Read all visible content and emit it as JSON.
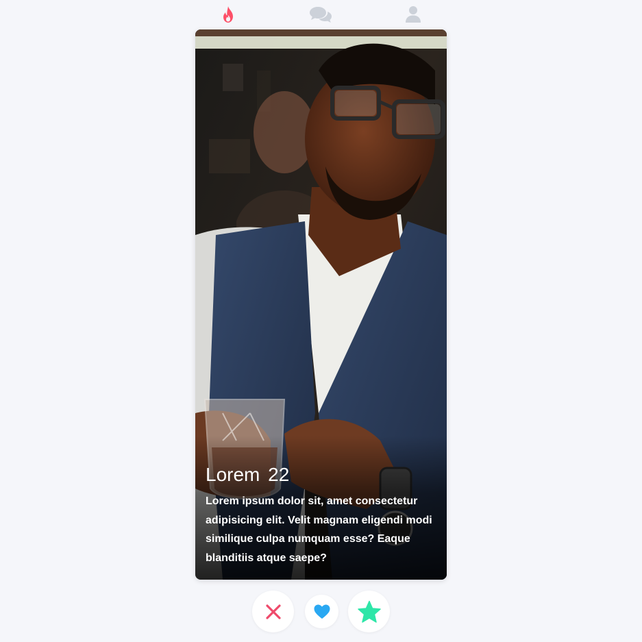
{
  "nav": {
    "items": [
      {
        "icon": "flame-icon",
        "active": true,
        "color": "#fd5068"
      },
      {
        "icon": "chat-icon",
        "active": false,
        "color": "#ccd1d9"
      },
      {
        "icon": "user-icon",
        "active": false,
        "color": "#ccd1d9"
      }
    ]
  },
  "card": {
    "name": "Lorem",
    "age": "22",
    "bio": "Lorem ipsum dolor sit, amet consectetur adipisicing elit. Velit magnam eligendi modi similique culpa numquam esse? Eaque blanditiis atque saepe?"
  },
  "actions": [
    {
      "icon": "x-icon",
      "color": "#ef4a6b"
    },
    {
      "icon": "heart-icon",
      "color": "#2aa8f2"
    },
    {
      "icon": "star-icon",
      "color": "#2ee6a8"
    }
  ]
}
